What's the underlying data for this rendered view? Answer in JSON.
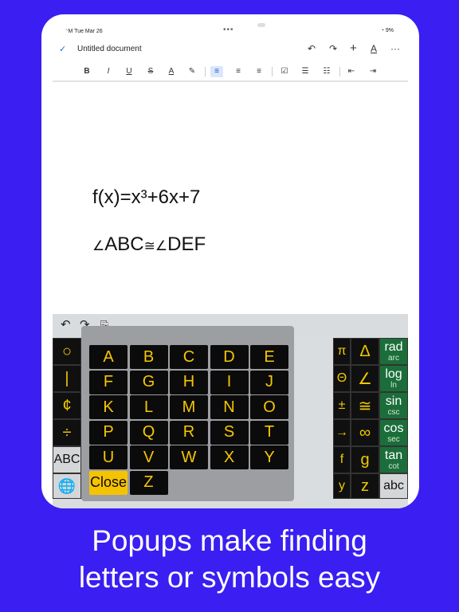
{
  "status": {
    "time": "⸌M",
    "date": "Tue Mar 26",
    "dots": "•••",
    "right": "9%"
  },
  "doc_toolbar": {
    "title": "Untitled document",
    "check": "✓",
    "undo": "↶",
    "redo": "↷",
    "add": "+",
    "text": "A",
    "more": "···"
  },
  "format": {
    "bold": "B",
    "italic": "I",
    "underline": "U",
    "strike": "S",
    "textcolor": "A",
    "highlight": "✎",
    "left": "≡",
    "center": "≡",
    "right": "≡",
    "check": "☑",
    "bullets": "☰",
    "numbers": "☷",
    "indent_less": "⇤",
    "indent_more": "⇥"
  },
  "doc": {
    "line1": "f(x)=x³+6x+7",
    "line2_a": "∠",
    "line2_b": "ABC",
    "line2_c": "≅",
    "line2_d": "∠",
    "line2_e": "DEF"
  },
  "kbbar": {
    "undo": "↶",
    "redo": "↷",
    "paste": "⎘"
  },
  "left_keys": [
    "○",
    "•",
    "|",
    "<",
    "¢",
    "≤",
    "÷",
    "{",
    "ABC",
    "[",
    "🌐",
    "←"
  ],
  "right_keys": [
    "Δ",
    "∠",
    "≅",
    "∞",
    "g",
    "z",
    "π",
    "Θ",
    "±",
    "→",
    "f",
    "y"
  ],
  "green_keys": [
    {
      "top": "rad",
      "sub": "arc"
    },
    {
      "top": "log",
      "sub": "ln"
    },
    {
      "top": "sin",
      "sub": "csc"
    },
    {
      "top": "cos",
      "sub": "sec"
    },
    {
      "top": "tan",
      "sub": "cot"
    }
  ],
  "corner_key": "abc",
  "popup": {
    "rows": [
      [
        "A",
        "B",
        "C",
        "D",
        "E"
      ],
      [
        "F",
        "G",
        "H",
        "I",
        "J"
      ],
      [
        "K",
        "L",
        "M",
        "N",
        "O"
      ],
      [
        "P",
        "Q",
        "R",
        "S",
        "T"
      ],
      [
        "U",
        "V",
        "W",
        "X",
        "Y"
      ]
    ],
    "close": "Close",
    "last": "Z"
  },
  "caption": {
    "line1": "Popups make finding",
    "line2": "letters or symbols easy"
  },
  "colors": {
    "background": "#3a1ef2",
    "key_text": "#f0c800",
    "green_key": "#1b6e3a",
    "blue_key": "#1866b2"
  }
}
